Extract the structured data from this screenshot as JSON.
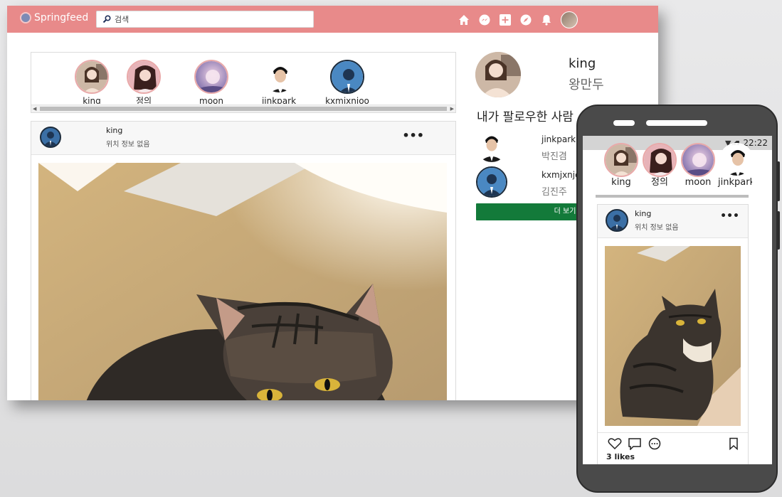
{
  "brand": {
    "name": "Springfeed"
  },
  "search": {
    "placeholder": "검색"
  },
  "nav": {
    "icons": [
      "home-icon",
      "messenger-icon",
      "new-post-icon",
      "explore-icon",
      "notifications-icon",
      "profile-avatar"
    ]
  },
  "stories": [
    {
      "name": "king"
    },
    {
      "name": "정의"
    },
    {
      "name": "moon"
    },
    {
      "name": "jinkpark"
    },
    {
      "name": "kxmjxnjoo"
    }
  ],
  "post": {
    "username": "king",
    "location": "위치 정보 없음",
    "menu": "•••"
  },
  "sidebar": {
    "username": "king",
    "real_name": "왕만두",
    "section_title": "내가 팔로우한 사람",
    "following": [
      {
        "id": "jinkpark",
        "name": "박진겸"
      },
      {
        "id": "kxmjxnjoo",
        "name": "김진주"
      }
    ],
    "more_label": "더 보기"
  },
  "phone": {
    "time": "22:22",
    "stories": [
      {
        "name": "king"
      },
      {
        "name": "정의"
      },
      {
        "name": "moon"
      },
      {
        "name": "jinkpark"
      }
    ],
    "post": {
      "username": "king",
      "location": "위치 정보 없음",
      "menu": "•••",
      "likes": "3 likes"
    }
  },
  "colors": {
    "topbar": "#e88a8a",
    "more_button": "#137a3a",
    "story_ring": "#e9a9a9"
  }
}
